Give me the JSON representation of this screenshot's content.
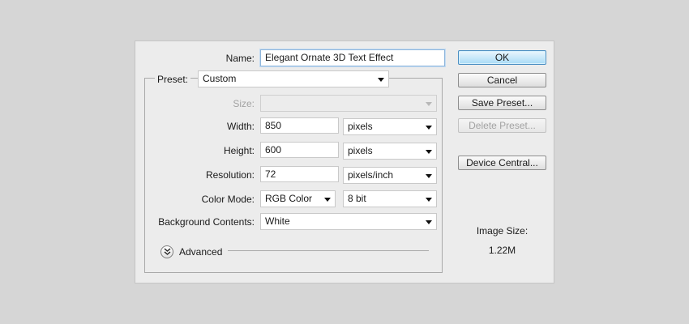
{
  "name_field": {
    "label": "Name:",
    "value": "Elegant Ornate 3D Text Effect"
  },
  "preset": {
    "label": "Preset:",
    "value": "Custom"
  },
  "size": {
    "label": "Size:",
    "value": ""
  },
  "width": {
    "label": "Width:",
    "value": "850",
    "unit": "pixels"
  },
  "height": {
    "label": "Height:",
    "value": "600",
    "unit": "pixels"
  },
  "resolution": {
    "label": "Resolution:",
    "value": "72",
    "unit": "pixels/inch"
  },
  "color_mode": {
    "label": "Color Mode:",
    "mode": "RGB Color",
    "depth": "8 bit"
  },
  "background": {
    "label": "Background Contents:",
    "value": "White"
  },
  "advanced": {
    "label": "Advanced"
  },
  "buttons": {
    "ok": "OK",
    "cancel": "Cancel",
    "save_preset": "Save Preset...",
    "delete_preset": "Delete Preset...",
    "device_central": "Device Central..."
  },
  "image_size": {
    "label": "Image Size:",
    "value": "1.22M"
  },
  "colors": {
    "page_bg": "#d6d6d6",
    "dialog_bg": "#ececec",
    "primary_button": "#a9dbf6",
    "focus_border": "#8fb6dc",
    "disabled_text": "#a3a3a3"
  },
  "icons": {
    "dropdown": "chevron-down-icon",
    "advanced_toggle": "double-chevron-down-icon"
  }
}
